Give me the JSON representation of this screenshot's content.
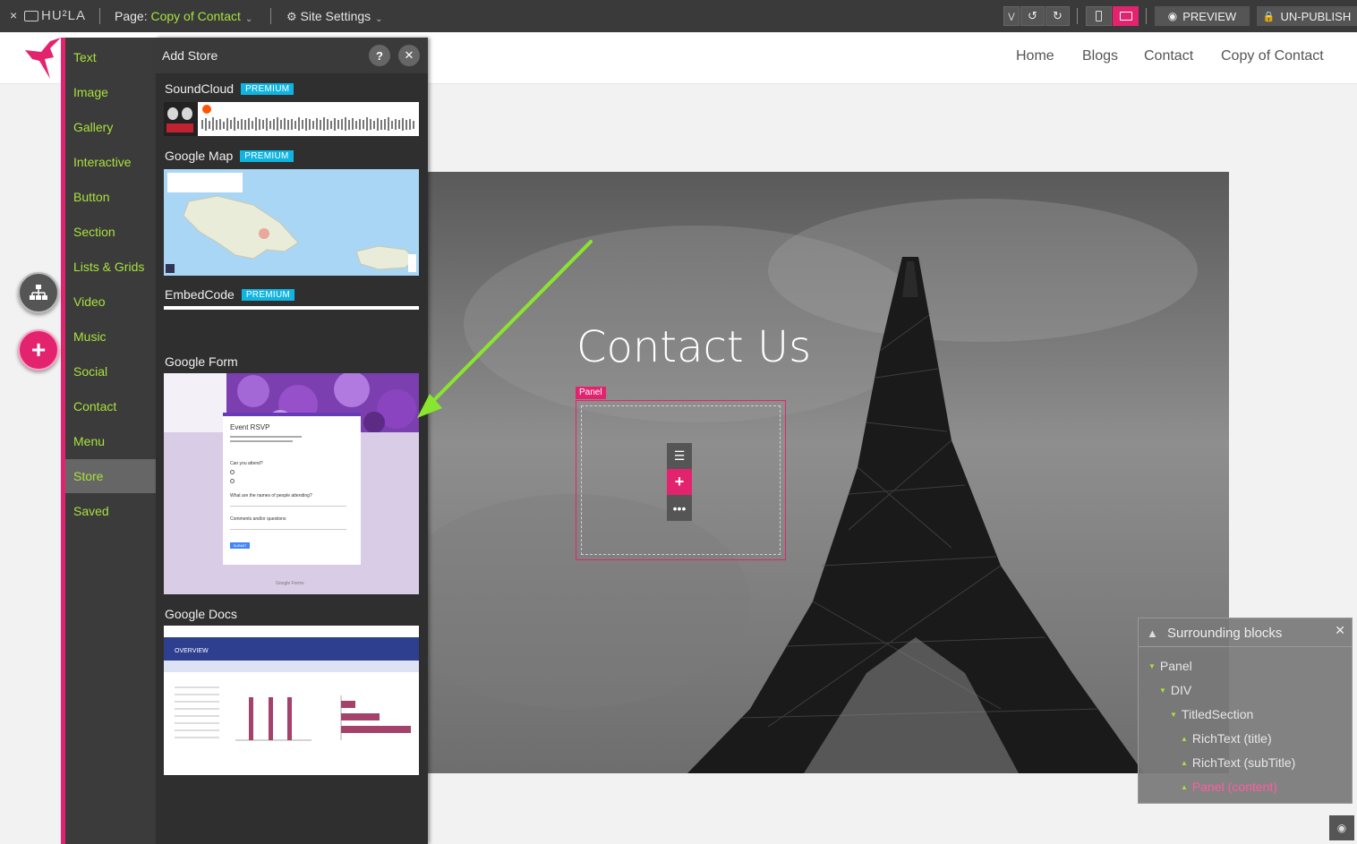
{
  "topbar": {
    "close_glyph": "×",
    "logo_text": "HU²LA",
    "page_label": "Page: ",
    "page_value": "Copy of Contact",
    "site_settings_label": "Site Settings",
    "preview_label": "PREVIEW",
    "unpublish_label": "UN-PUBLISH"
  },
  "nav": {
    "items": [
      "Home",
      "Blogs",
      "Contact",
      "Copy of Contact"
    ]
  },
  "categories": [
    "Text",
    "Image",
    "Gallery",
    "Interactive",
    "Button",
    "Section",
    "Lists & Grids",
    "Video",
    "Music",
    "Social",
    "Contact",
    "Menu",
    "Store",
    "Saved"
  ],
  "active_category": "Store",
  "store": {
    "title": "Add Store",
    "help_glyph": "?",
    "close_glyph": "✕",
    "premium_badge": "PREMIUM",
    "items": [
      {
        "name": "SoundCloud",
        "premium": true
      },
      {
        "name": "Google Map",
        "premium": true
      },
      {
        "name": "EmbedCode",
        "premium": true
      },
      {
        "name": "Google Form",
        "premium": false
      },
      {
        "name": "Google Docs",
        "premium": false
      }
    ],
    "form_preview": {
      "heading": "Event RSVP",
      "question1": "Can you attend?",
      "question2": "What are the names of people attending?",
      "question3": "Comments and/or questions",
      "submit": "SUBMIT",
      "footer": "Google Forms"
    },
    "docs_preview": {
      "heading": "OVERVIEW"
    }
  },
  "hero": {
    "title": "Contact Us",
    "panel_tag": "Panel"
  },
  "surrounding": {
    "title": "Surrounding blocks",
    "close_glyph": "✕",
    "items": [
      {
        "label": "Panel",
        "dir": "down",
        "level": 0
      },
      {
        "label": "DIV",
        "dir": "down",
        "level": 1
      },
      {
        "label": "TitledSection",
        "dir": "down",
        "level": 2
      },
      {
        "label": "RichText (title)",
        "dir": "up",
        "level": 3
      },
      {
        "label": "RichText (subTitle)",
        "dir": "up",
        "level": 3
      },
      {
        "label": "Panel (content)",
        "dir": "up",
        "level": 3,
        "active": true
      }
    ]
  },
  "colors": {
    "accent_pink": "#e4236f",
    "accent_green": "#a8e23c",
    "premium_blue": "#10b4e0"
  }
}
